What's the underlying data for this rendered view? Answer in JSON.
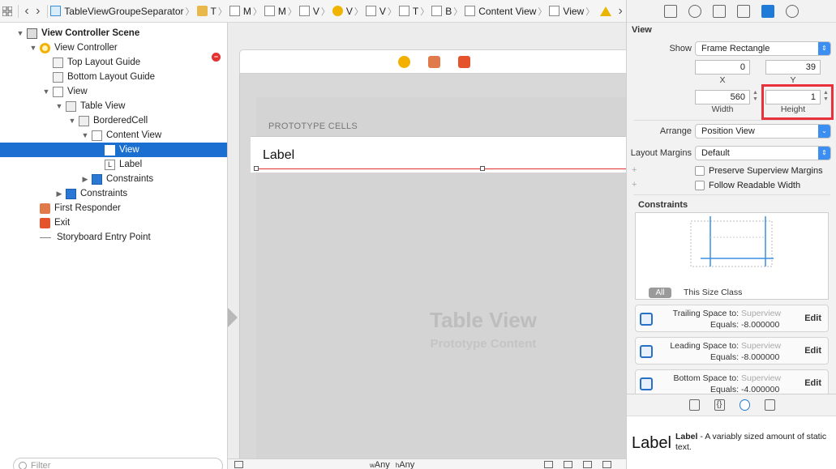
{
  "jumpbar": {
    "crumbs": [
      {
        "label": "TableViewGroupeSeparator",
        "icon": "file-icon"
      },
      {
        "label": "T",
        "icon": "folder-icon"
      },
      {
        "label": "M",
        "icon": "storyboard-icon"
      },
      {
        "label": "M",
        "icon": "storyboard-icon"
      },
      {
        "label": "V",
        "icon": "scene-icon"
      },
      {
        "label": "V",
        "icon": "view-controller-icon"
      },
      {
        "label": "V",
        "icon": "view-icon"
      },
      {
        "label": "T",
        "icon": "table-view-icon"
      },
      {
        "label": "B",
        "icon": "cell-icon"
      },
      {
        "label": "Content View",
        "icon": "view-icon"
      },
      {
        "label": "View",
        "icon": "view-icon"
      }
    ]
  },
  "outline": {
    "rows": [
      {
        "label": "View Controller Scene",
        "indent": 0,
        "disc": "▼",
        "icon": "scene",
        "bold": true
      },
      {
        "label": "View Controller",
        "indent": 1,
        "disc": "▼",
        "icon": "vc"
      },
      {
        "label": "Top Layout Guide",
        "indent": 2,
        "disc": "",
        "icon": "guide"
      },
      {
        "label": "Bottom Layout Guide",
        "indent": 2,
        "disc": "",
        "icon": "guide"
      },
      {
        "label": "View",
        "indent": 2,
        "disc": "▼",
        "icon": "view"
      },
      {
        "label": "Table View",
        "indent": 3,
        "disc": "▼",
        "icon": "tv"
      },
      {
        "label": "BorderedCell",
        "indent": 4,
        "disc": "▼",
        "icon": "tv"
      },
      {
        "label": "Content View",
        "indent": 5,
        "disc": "▼",
        "icon": "view"
      },
      {
        "label": "View",
        "indent": 6,
        "disc": "",
        "icon": "view",
        "selected": true
      },
      {
        "label": "Label",
        "indent": 6,
        "disc": "",
        "icon": "lbl"
      },
      {
        "label": "Constraints",
        "indent": 5,
        "disc": "▶",
        "icon": "cons"
      },
      {
        "label": "Constraints",
        "indent": 3,
        "disc": "▶",
        "icon": "cons"
      },
      {
        "label": "First Responder",
        "indent": 1,
        "disc": "",
        "icon": "fr"
      },
      {
        "label": "Exit",
        "indent": 1,
        "disc": "",
        "icon": "exit"
      },
      {
        "label": "Storyboard Entry Point",
        "indent": 1,
        "disc": "",
        "icon": "entry"
      }
    ],
    "filter_placeholder": "Filter"
  },
  "canvas": {
    "prototype_cells": "PROTOTYPE CELLS",
    "cell_label": "Label",
    "watermark_title": "Table View",
    "watermark_subtitle": "Prototype Content",
    "size_class_w": "w",
    "size_class_w_value": "Any",
    "size_class_h": "h",
    "size_class_h_value": "Any"
  },
  "inspector": {
    "section_title": "View",
    "show_label": "Show",
    "show_value": "Frame Rectangle",
    "x_value": "0",
    "y_value": "39",
    "x_caption": "X",
    "y_caption": "Y",
    "width_value": "560",
    "height_value": "1",
    "width_caption": "Width",
    "height_caption": "Height",
    "arrange_label": "Arrange",
    "arrange_value": "Position View",
    "margins_label": "Layout Margins",
    "margins_value": "Default",
    "preserve_label": "Preserve Superview Margins",
    "readable_label": "Follow Readable Width",
    "constraints_title": "Constraints",
    "seg_all": "All",
    "size_class_text": "This Size Class",
    "constraints": [
      {
        "title": "Trailing Space to:",
        "target": "Superview",
        "equals_label": "Equals:",
        "equals": "-8.000000",
        "edit": "Edit"
      },
      {
        "title": "Leading Space to:",
        "target": "Superview",
        "equals_label": "Equals:",
        "equals": "-8.000000",
        "edit": "Edit"
      },
      {
        "title": "Bottom Space to:",
        "target": "Superview",
        "equals_label": "Equals:",
        "equals": "-4.000000",
        "edit": "Edit"
      }
    ],
    "library": {
      "big_label": "Label",
      "name": "Label",
      "description": " - A variably sized amount of static text."
    },
    "highlight_color": "#e8313a"
  }
}
